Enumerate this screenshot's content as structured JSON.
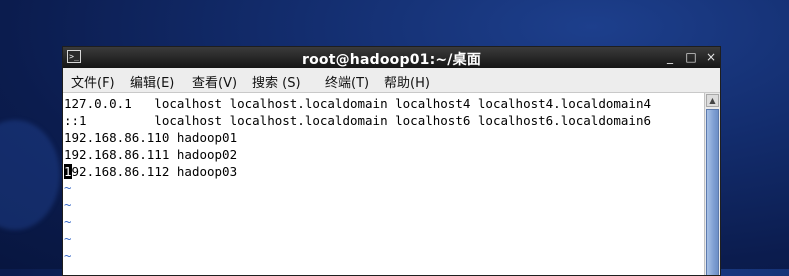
{
  "window": {
    "title": "root@hadoop01:~/桌面",
    "icon": "terminal-icon",
    "controls": {
      "minimize": "_",
      "maximize": "□",
      "close": "×"
    }
  },
  "menubar": {
    "items": [
      {
        "label": "文件(F)"
      },
      {
        "label": "编辑(E)"
      },
      {
        "label": "查看(V)"
      },
      {
        "label": "搜索 (S)"
      },
      {
        "label": "终端(T)"
      },
      {
        "label": "帮助(H)"
      }
    ]
  },
  "terminal": {
    "lines": [
      "127.0.0.1   localhost localhost.localdomain localhost4 localhost4.localdomain4",
      "::1         localhost localhost.localdomain localhost6 localhost6.localdomain6",
      "192.168.86.110 hadoop01",
      "192.168.86.111 hadoop02",
      "92.168.86.112 hadoop03"
    ],
    "cursor_char": "1",
    "tildes": [
      "~",
      "~",
      "~",
      "~",
      "~"
    ]
  }
}
